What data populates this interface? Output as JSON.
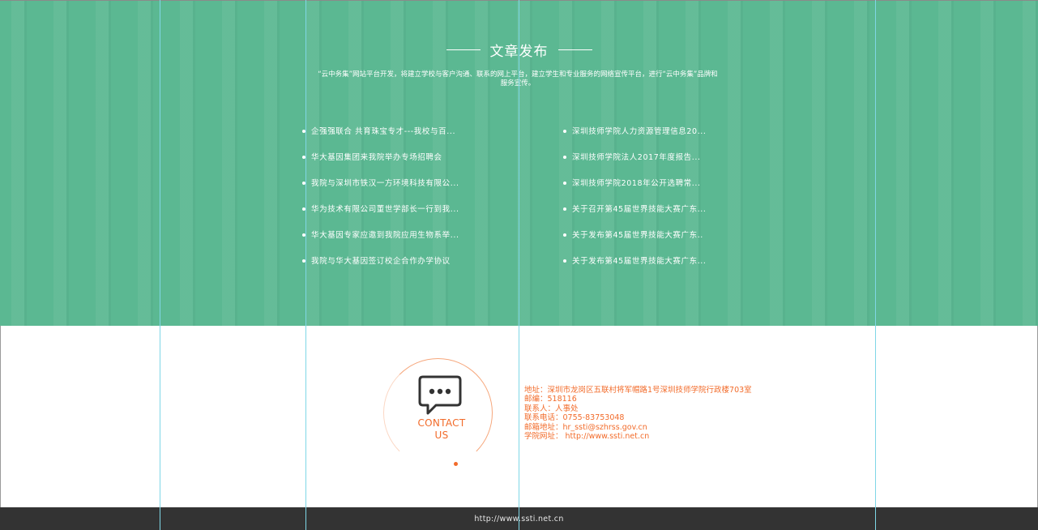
{
  "section": {
    "title": "文章发布",
    "intro": "“云中务集”网站平台开发，将建立学校与客户沟通、联系的网上平台，建立学生和专业服务的网络宣传平台，进行“云中务集”品牌和服务宣传。"
  },
  "news": {
    "left": [
      "企强强联合 共育珠宝专才---我校与百...",
      "华大基因集团来我院举办专场招聘会",
      "我院与深圳市铁汉一方环境科技有限公...",
      "华为技术有限公司董世学部长一行到我...",
      "华大基因专家应邀到我院应用生物系举...",
      "我院与华大基因签订校企合作办学协议"
    ],
    "right": [
      "深圳技师学院人力资源管理信息20...",
      "深圳技师学院法人2017年度报告...",
      "深圳技师学院2018年公开选聘常...",
      "关于召开第45届世界技能大赛广东...",
      "关于发布第45届世界技能大赛广东..",
      "关于发布第45届世界技能大赛广东..."
    ]
  },
  "contact": {
    "label_line1": "CONTACT",
    "label_line2": "US",
    "icon": "chat-bubble-icon",
    "accent_color": "#f26b2a",
    "lines": [
      "地址：深圳市龙岗区五联村将军帽路1号深圳技师学院行政楼703室",
      "邮编：518116",
      "联系人：人事处",
      "联系电话：0755-83753048",
      "邮箱地址：hr_ssti@szhrss.gov.cn",
      "学院网址： http://www.ssti.net.cn"
    ]
  },
  "footer": {
    "link": "http://www.ssti.net.cn"
  },
  "colors": {
    "band_green": "#5bb892",
    "footer_bg": "#333333",
    "guide_cyan": "#7fd7e6"
  }
}
